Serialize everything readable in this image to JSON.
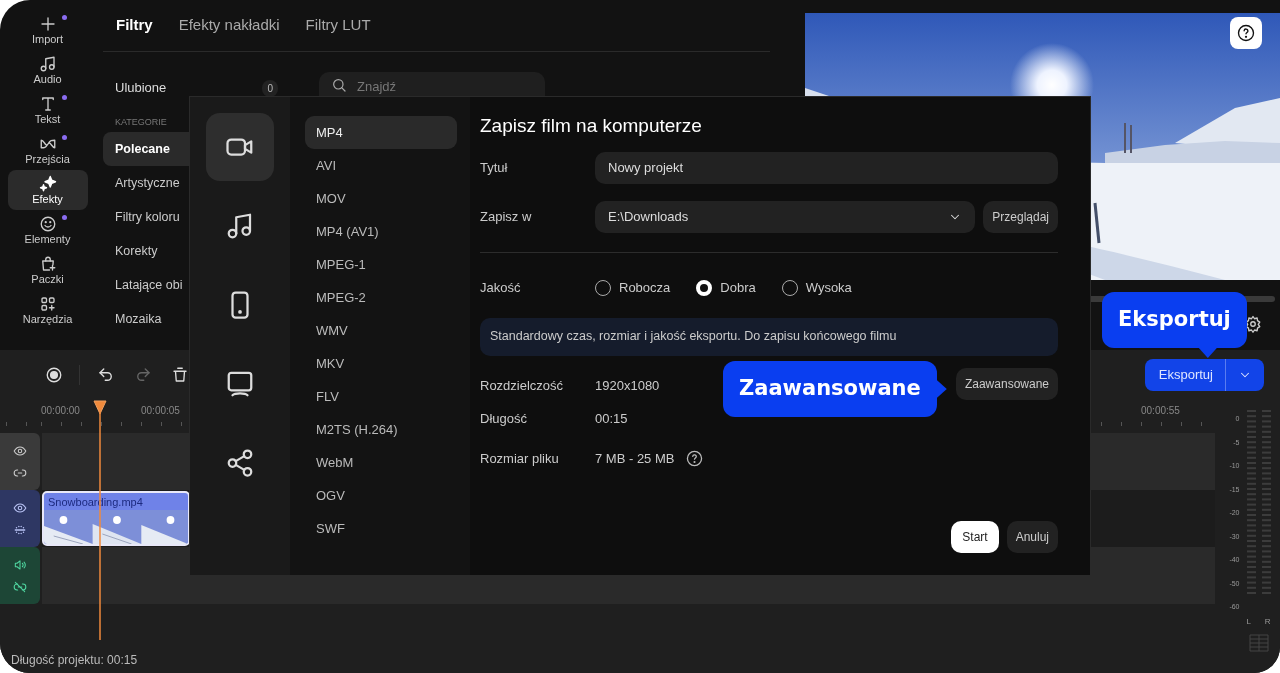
{
  "sidebar": {
    "items": [
      {
        "kind": "plus",
        "label": "Import",
        "selected": false,
        "dot": true
      },
      {
        "kind": "music",
        "label": "Audio",
        "selected": false,
        "dot": false
      },
      {
        "kind": "text",
        "label": "Tekst",
        "selected": false,
        "dot": true
      },
      {
        "kind": "bowtie",
        "label": "Przejścia",
        "selected": false,
        "dot": true
      },
      {
        "kind": "sparkle",
        "label": "Efekty",
        "selected": true,
        "dot": false
      },
      {
        "kind": "smile",
        "label": "Elementy",
        "selected": false,
        "dot": true
      },
      {
        "kind": "bag",
        "label": "Paczki",
        "selected": false,
        "dot": false
      },
      {
        "kind": "grid",
        "label": "Narzędzia",
        "selected": false,
        "dot": false
      }
    ]
  },
  "effects_panel": {
    "tabs": [
      {
        "label": "Filtry",
        "selected": true
      },
      {
        "label": "Efekty nakładki",
        "selected": false
      },
      {
        "label": "Filtry LUT",
        "selected": false
      }
    ],
    "favorites": {
      "label": "Ulubione",
      "count": "0"
    },
    "search": {
      "placeholder": "Znajdź"
    },
    "category_heading": "KATEGORIE",
    "categories": [
      {
        "label": "Polecane",
        "selected": true
      },
      {
        "label": "Artystyczne",
        "selected": false
      },
      {
        "label": "Filtry koloru",
        "selected": false
      },
      {
        "label": "Korekty",
        "selected": false
      },
      {
        "label": "Latające obi",
        "selected": false
      },
      {
        "label": "Mozaika",
        "selected": false
      }
    ]
  },
  "timeline": {
    "toolbar": [
      {
        "kind": "record",
        "disabled": false
      },
      {
        "kind": "undo",
        "disabled": false
      },
      {
        "kind": "redo",
        "disabled": true
      },
      {
        "kind": "trash",
        "disabled": false
      }
    ],
    "export_button": {
      "label": "Eksportuj"
    },
    "ruler": [
      "00:00:00",
      "00:00:05",
      "00:00:55"
    ],
    "tracks": [
      {
        "kind": "empty"
      },
      {
        "kind": "video",
        "clip": "Snowboarding.mp4"
      },
      {
        "kind": "audio"
      }
    ],
    "meter": {
      "scale": [
        "0",
        "-5",
        "-10",
        "-15",
        "-20",
        "-30",
        "-40",
        "-50",
        "-60"
      ],
      "channels": [
        "L",
        "R"
      ]
    },
    "project_length": "Długość projektu: 00:15"
  },
  "dialog": {
    "categories": [
      {
        "kind": "video",
        "selected": true
      },
      {
        "kind": "music",
        "selected": false
      },
      {
        "kind": "phone",
        "selected": false
      },
      {
        "kind": "monitor",
        "selected": false
      },
      {
        "kind": "share",
        "selected": false
      }
    ],
    "formats": [
      {
        "label": "MP4",
        "selected": true
      },
      {
        "label": "AVI",
        "selected": false
      },
      {
        "label": "MOV",
        "selected": false
      },
      {
        "label": "MP4 (AV1)",
        "selected": false
      },
      {
        "label": "MPEG-1",
        "selected": false
      },
      {
        "label": "MPEG-2",
        "selected": false
      },
      {
        "label": "WMV",
        "selected": false
      },
      {
        "label": "MKV",
        "selected": false
      },
      {
        "label": "FLV",
        "selected": false
      },
      {
        "label": "M2TS (H.264)",
        "selected": false
      },
      {
        "label": "WebM",
        "selected": false
      },
      {
        "label": "OGV",
        "selected": false
      },
      {
        "label": "SWF",
        "selected": false
      }
    ],
    "title": "Zapisz film na komputerze",
    "name_field": {
      "label": "Tytuł",
      "value": "Nowy projekt"
    },
    "folder_field": {
      "label": "Zapisz w",
      "value": "E:\\Downloads",
      "browse": "Przeglądaj"
    },
    "quality": {
      "label": "Jakość",
      "options": [
        {
          "label": "Robocza",
          "selected": false
        },
        {
          "label": "Dobra",
          "selected": true
        },
        {
          "label": "Wysoka",
          "selected": false
        }
      ]
    },
    "info": "Standardowy czas, rozmiar i jakość eksportu. Do zapisu końcowego filmu",
    "details": [
      {
        "label": "Rozdzielczość",
        "value": "1920x1080"
      },
      {
        "label": "Długość",
        "value": "00:15"
      },
      {
        "label": "Rozmiar pliku",
        "value": "7 MB - 25 MB",
        "help": true
      }
    ],
    "advanced": "Zaawansowane",
    "start": "Start",
    "cancel": "Anuluj"
  },
  "callouts": [
    {
      "text": "Zaawansowane",
      "kind": "side"
    },
    {
      "text": "Eksportuj",
      "kind": "below"
    }
  ]
}
